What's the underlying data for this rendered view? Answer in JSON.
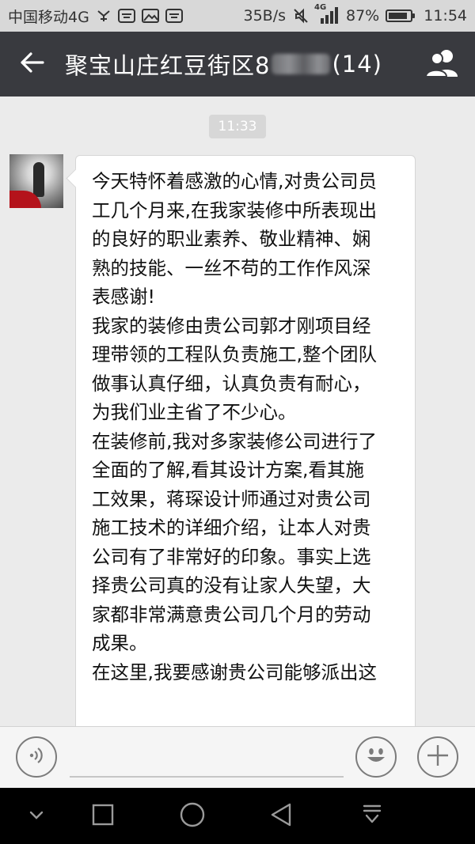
{
  "status_bar": {
    "carrier": "中国移动4G",
    "speed": "35B/s",
    "network_badge": "4G",
    "battery": "87%",
    "battery_level": 0.87,
    "time": "11:54",
    "icons": [
      "usb-icon",
      "taobao-icon",
      "image-icon",
      "taobao-icon",
      "mute-icon",
      "signal-icon",
      "battery-icon"
    ]
  },
  "header": {
    "back_icon": "back-arrow-icon",
    "title_prefix": "聚宝山庄红豆街区8",
    "title_suffix": "(14)",
    "group_icon": "group-members-icon"
  },
  "chat": {
    "timestamp": "11:33",
    "message": {
      "avatar": "sender-avatar",
      "lines": [
        "今天特怀着感激的心情,对贵公司员",
        "工几个月来,在我家装修中所表现出",
        "的良好的职业素养、敬业精神、娴",
        "熟的技能、一丝不苟的工作作风深",
        "表感谢!",
        "我家的装修由贵公司郭才刚项目经",
        "理带领的工程队负责施工,整个团队",
        "做事认真仔细，认真负责有耐心，",
        "为我们业主省了不少心。",
        "在装修前,我对多家装修公司进行了",
        "全面的了解,看其设计方案,看其施",
        "工效果，蒋琛设计师通过对贵公司",
        "施工技术的详细介绍，让本人对贵",
        "公司有了非常好的印象。事实上选",
        "择贵公司真的没有让家人失望，大",
        "家都非常满意贵公司几个月的劳动",
        "成果。",
        "在这里,我要感谢贵公司能够派出这"
      ]
    }
  },
  "input_bar": {
    "voice_icon": "voice-input-icon",
    "emoji_icon": "emoji-icon",
    "plus_icon": "plus-icon"
  },
  "nav_bar": {
    "icons": [
      "collapse-icon",
      "recents-icon",
      "home-icon",
      "back-icon",
      "notification-pull-icon"
    ]
  }
}
